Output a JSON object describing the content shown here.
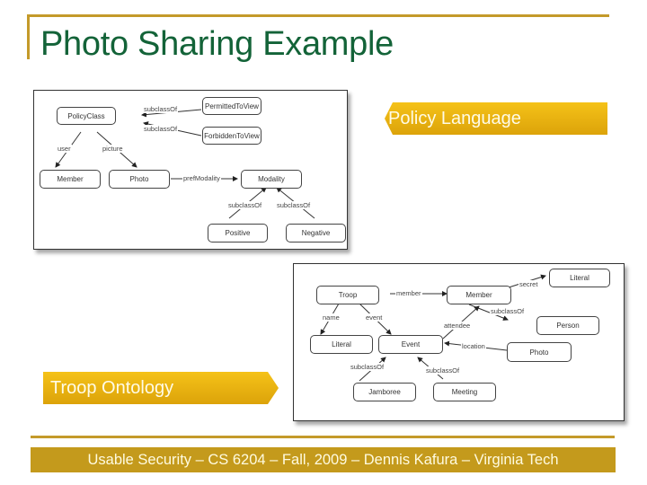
{
  "slide": {
    "title": "Photo Sharing Example",
    "callouts": {
      "policy_language": "Policy Language",
      "troop_ontology": "Troop Ontology"
    },
    "footer": "Usable Security – CS 6204 – Fall, 2009 – Dennis Kafura – Virginia Tech",
    "colors": {
      "title": "#136338",
      "accent": "#c49a2a",
      "callout": "#e8b010"
    }
  },
  "policy_diagram": {
    "nodes": {
      "policy_class": "PolicyClass",
      "permitted": "PermittedToView",
      "forbidden": "ForbiddenToView",
      "member": "Member",
      "photo": "Photo",
      "modality": "Modality",
      "positive": "Positive",
      "negative": "Negative"
    },
    "edges": {
      "subclass1": "subclassOf",
      "subclass2": "subclassOf",
      "user": "user",
      "picture": "picture",
      "pref": "prefModality",
      "subclass3": "subclassOf",
      "subclass4": "subclassOf"
    }
  },
  "troop_diagram": {
    "nodes": {
      "troop": "Troop",
      "member": "Member",
      "literal1": "Literal",
      "person": "Person",
      "literal2": "Literal",
      "event": "Event",
      "photo": "Photo",
      "jamboree": "Jamboree",
      "meeting": "Meeting"
    },
    "edges": {
      "member": "member",
      "secret": "secret",
      "subclass": "subclassOf",
      "name": "name",
      "event": "event",
      "attendee": "attendee",
      "location": "location",
      "subclass2": "subclassOf",
      "subclass3": "subclassOf"
    }
  }
}
